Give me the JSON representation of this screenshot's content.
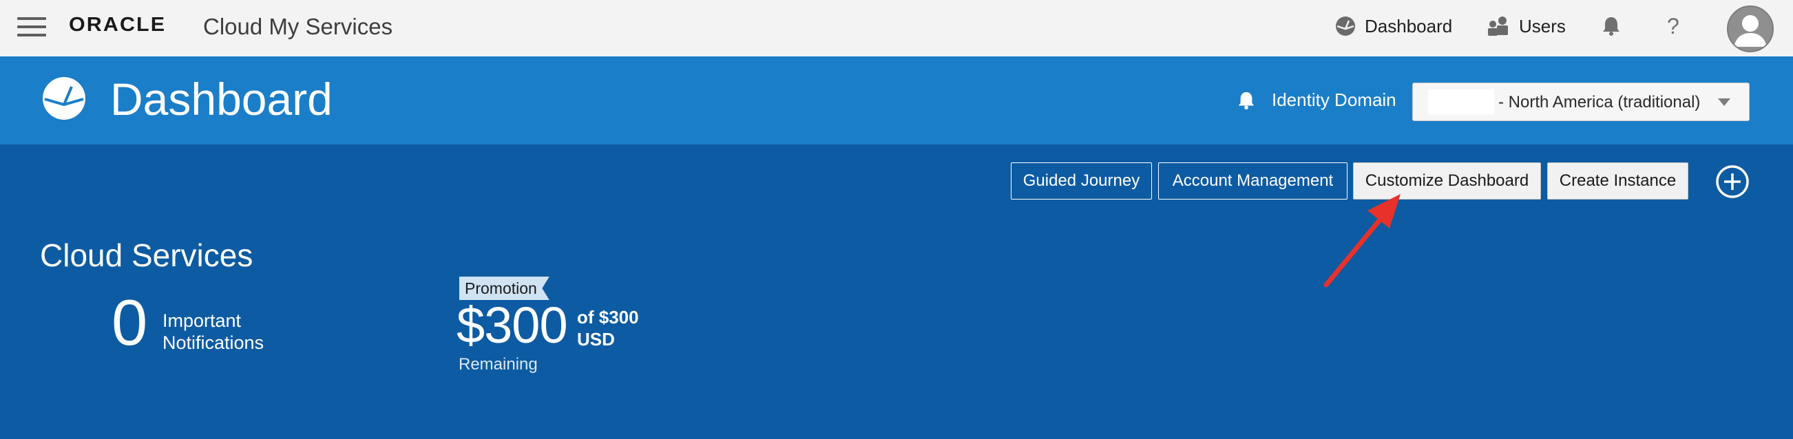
{
  "header": {
    "brand": "ORACLE",
    "app_title": "Cloud My Services",
    "nav": {
      "dashboard_label": "Dashboard",
      "users_label": "Users",
      "help_glyph": "?"
    },
    "icons": [
      "menu-icon",
      "dashboard-icon",
      "users-icon",
      "bell-icon",
      "help-icon",
      "user-avatar-icon"
    ]
  },
  "banner": {
    "title": "Dashboard",
    "identity_domain_label": "Identity Domain",
    "identity_domain_value": "- North America (traditional)"
  },
  "toolbar": {
    "guided_journey": "Guided Journey",
    "account_management": "Account Management",
    "customize_dashboard": "Customize Dashboard",
    "create_instance": "Create Instance"
  },
  "cloud_services": {
    "title": "Cloud Services",
    "notifications_count": "0",
    "notifications_label_line1": "Important",
    "notifications_label_line2": "Notifications",
    "promotion_tag": "Promotion",
    "promotion_amount": "$300",
    "promotion_of_line1": "of $300",
    "promotion_of_line2": "USD",
    "promotion_remaining": "Remaining"
  },
  "colors": {
    "topbar_bg": "#f3f3f4",
    "banner_bg": "#1b7ec8",
    "main_bg": "#0d5ba2",
    "arrow": "#e8312a"
  }
}
